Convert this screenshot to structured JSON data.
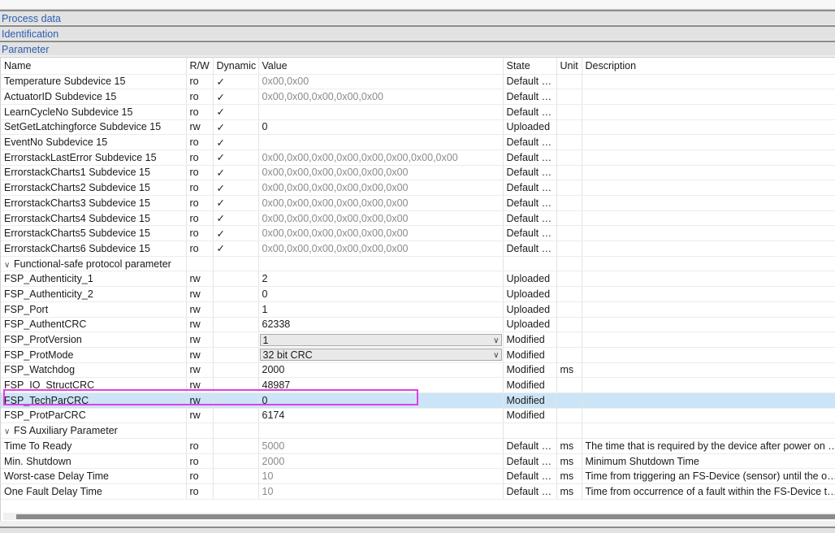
{
  "sections": {
    "process_data": "Process data",
    "identification": "Identification",
    "parameter": "Parameter"
  },
  "columns": [
    "Name",
    "R/W",
    "Dynamic",
    "Value",
    "State",
    "Unit",
    "Description"
  ],
  "rows": [
    {
      "name": "Temperature Subdevice 15",
      "rw": "ro",
      "dynamic": "✓",
      "value": "0x00,0x00",
      "state": "Default va...",
      "unit": "",
      "description": ""
    },
    {
      "name": "ActuatorID Subdevice 15",
      "rw": "ro",
      "dynamic": "✓",
      "value": "0x00,0x00,0x00,0x00,0x00",
      "state": "Default va...",
      "unit": "",
      "description": ""
    },
    {
      "name": "LearnCycleNo Subdevice 15",
      "rw": "ro",
      "dynamic": "✓",
      "value": "",
      "state": "Default va...",
      "unit": "",
      "description": ""
    },
    {
      "name": "SetGetLatchingforce Subdevice 15",
      "rw": "rw",
      "dynamic": "✓",
      "value": "0",
      "state": "Uploaded",
      "unit": "",
      "description": ""
    },
    {
      "name": "EventNo Subdevice 15",
      "rw": "ro",
      "dynamic": "✓",
      "value": "",
      "state": "Default va...",
      "unit": "",
      "description": ""
    },
    {
      "name": "ErrorstackLastError Subdevice 15",
      "rw": "ro",
      "dynamic": "✓",
      "value": "0x00,0x00,0x00,0x00,0x00,0x00,0x00,0x00",
      "state": "Default va...",
      "unit": "",
      "description": ""
    },
    {
      "name": "ErrorstackCharts1 Subdevice 15",
      "rw": "ro",
      "dynamic": "✓",
      "value": "0x00,0x00,0x00,0x00,0x00,0x00",
      "state": "Default va...",
      "unit": "",
      "description": ""
    },
    {
      "name": "ErrorstackCharts2 Subdevice 15",
      "rw": "ro",
      "dynamic": "✓",
      "value": "0x00,0x00,0x00,0x00,0x00,0x00",
      "state": "Default va...",
      "unit": "",
      "description": ""
    },
    {
      "name": "ErrorstackCharts3 Subdevice 15",
      "rw": "ro",
      "dynamic": "✓",
      "value": "0x00,0x00,0x00,0x00,0x00,0x00",
      "state": "Default va...",
      "unit": "",
      "description": ""
    },
    {
      "name": "ErrorstackCharts4 Subdevice 15",
      "rw": "ro",
      "dynamic": "✓",
      "value": "0x00,0x00,0x00,0x00,0x00,0x00",
      "state": "Default va...",
      "unit": "",
      "description": ""
    },
    {
      "name": "ErrorstackCharts5 Subdevice 15",
      "rw": "ro",
      "dynamic": "✓",
      "value": "0x00,0x00,0x00,0x00,0x00,0x00",
      "state": "Default va...",
      "unit": "",
      "description": ""
    },
    {
      "name": "ErrorstackCharts6 Subdevice 15",
      "rw": "ro",
      "dynamic": "✓",
      "value": "0x00,0x00,0x00,0x00,0x00,0x00",
      "state": "Default va...",
      "unit": "",
      "description": ""
    },
    {
      "group": "Functional-safe protocol parameter"
    },
    {
      "name": "FSP_Authenticity_1",
      "rw": "rw",
      "dynamic": "",
      "value": "2",
      "state": "Uploaded",
      "unit": "",
      "description": ""
    },
    {
      "name": "FSP_Authenticity_2",
      "rw": "rw",
      "dynamic": "",
      "value": "0",
      "state": "Uploaded",
      "unit": "",
      "description": ""
    },
    {
      "name": "FSP_Port",
      "rw": "rw",
      "dynamic": "",
      "value": "1",
      "state": "Uploaded",
      "unit": "",
      "description": ""
    },
    {
      "name": "FSP_AuthentCRC",
      "rw": "rw",
      "dynamic": "",
      "value": "62338",
      "state": "Uploaded",
      "unit": "",
      "description": ""
    },
    {
      "name": "FSP_ProtVersion",
      "rw": "rw",
      "dynamic": "",
      "value": "1",
      "state": "Modified",
      "unit": "",
      "description": "",
      "dropdown": true
    },
    {
      "name": "FSP_ProtMode",
      "rw": "rw",
      "dynamic": "",
      "value": "32 bit CRC",
      "state": "Modified",
      "unit": "",
      "description": "",
      "dropdown": true
    },
    {
      "name": "FSP_Watchdog",
      "rw": "rw",
      "dynamic": "",
      "value": "2000",
      "state": "Modified",
      "unit": "ms",
      "description": ""
    },
    {
      "name": "FSP_IO_StructCRC",
      "rw": "rw",
      "dynamic": "",
      "value": "48987",
      "state": "Modified",
      "unit": "",
      "description": ""
    },
    {
      "name": "FSP_TechParCRC",
      "rw": "rw",
      "dynamic": "",
      "value": "0",
      "state": "Modified",
      "unit": "",
      "description": "",
      "selected": true
    },
    {
      "name": "FSP_ProtParCRC",
      "rw": "rw",
      "dynamic": "",
      "value": "6174",
      "state": "Modified",
      "unit": "",
      "description": ""
    },
    {
      "group": "FS Auxiliary Parameter"
    },
    {
      "name": "Time To Ready",
      "rw": "ro",
      "dynamic": "",
      "value": "5000",
      "state": "Default va...",
      "unit": "ms",
      "description": "The time that is required by the device after power on in or"
    },
    {
      "name": "Min. Shutdown",
      "rw": "ro",
      "dynamic": "",
      "value": "2000",
      "state": "Default va...",
      "unit": "ms",
      "description": "Minimum Shutdown Time"
    },
    {
      "name": "Worst-case Delay Time",
      "rw": "ro",
      "dynamic": "",
      "value": "10",
      "state": "Default va...",
      "unit": "ms",
      "description": "Time from triggering an FS-Device (sensor) until the output"
    },
    {
      "name": "One Fault Delay Time",
      "rw": "ro",
      "dynamic": "",
      "value": "10",
      "state": "Default va...",
      "unit": "ms",
      "description": "Time from occurrence of a fault within the FS-Device to a c"
    }
  ],
  "dropdown_icon": "chevron-down-icon",
  "group_icon": "chevron-down-icon",
  "colors": {
    "selected_row": "#cce4f7",
    "highlight": "#e040e0",
    "section_text": "#2b5fb0"
  }
}
